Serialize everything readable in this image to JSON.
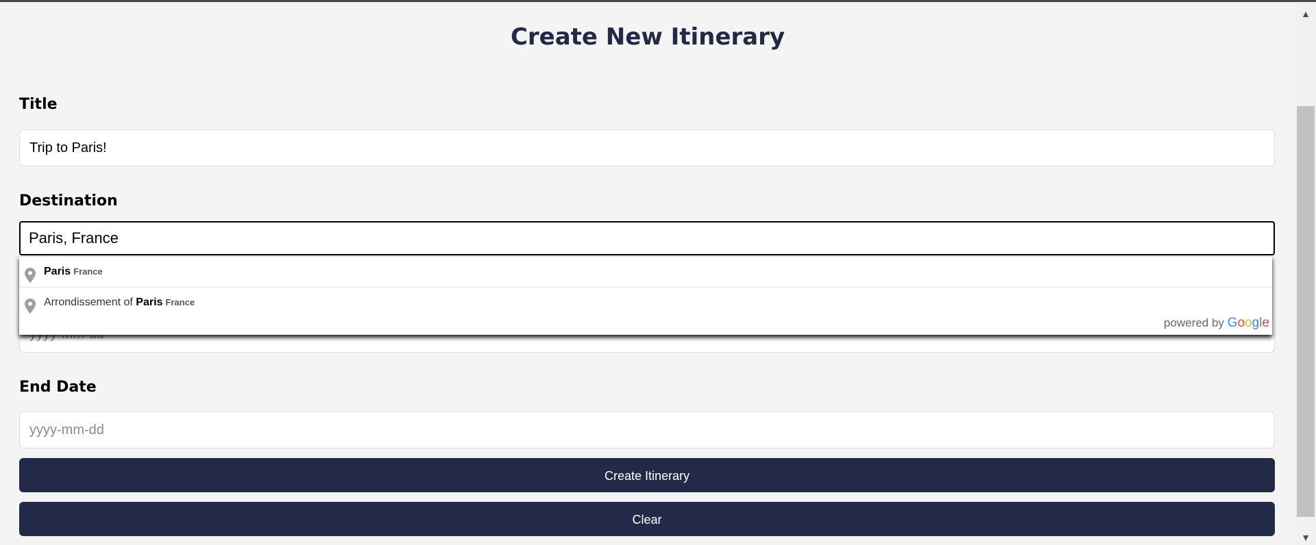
{
  "page": {
    "title": "Create New Itinerary"
  },
  "form": {
    "title_label": "Title",
    "title_value": "Trip to Paris!",
    "destination_label": "Destination",
    "destination_value": "Paris, France",
    "start_date_placeholder": "yyyy-mm-dd",
    "end_date_label": "End Date",
    "end_date_placeholder": "yyyy-mm-dd"
  },
  "autocomplete": {
    "suggestions": [
      {
        "prefix": "",
        "match": "Paris",
        "secondary": "France"
      },
      {
        "prefix": "Arrondissement of ",
        "match": "Paris",
        "secondary": "France"
      }
    ],
    "powered_by": "powered by",
    "google_letters": [
      "G",
      "o",
      "o",
      "g",
      "l",
      "e"
    ]
  },
  "buttons": {
    "create": "Create Itinerary",
    "clear": "Clear"
  },
  "colors": {
    "primary": "#232a47",
    "background": "#f4f4f4"
  },
  "icons": {
    "suggestion": "map-pin-icon",
    "scroll_up": "arrow-up-icon",
    "scroll_down": "arrow-down-icon"
  }
}
